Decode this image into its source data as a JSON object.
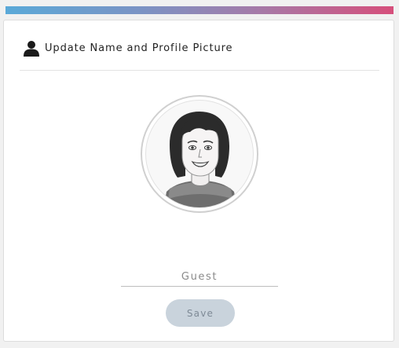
{
  "accent_gradient": [
    "#5aa9d8",
    "#a57aa8",
    "#d64f7b"
  ],
  "header": {
    "icon": "user-icon",
    "title": "Update Name and Profile Picture"
  },
  "profile": {
    "avatar_icon": "avatar-illustration",
    "name_value": "",
    "name_placeholder": "Guest"
  },
  "actions": {
    "save_label": "Save",
    "save_state": "disabled"
  }
}
